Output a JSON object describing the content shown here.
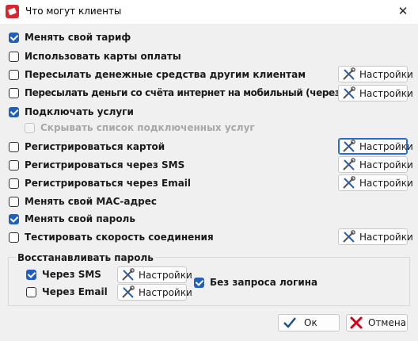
{
  "window": {
    "title": "Что могут клиенты"
  },
  "options": [
    {
      "label": "Менять свой тариф",
      "checked": true,
      "disabled": false,
      "button": null
    },
    {
      "label": "Использовать карты оплаты",
      "checked": false,
      "disabled": false,
      "button": null
    },
    {
      "label": "Пересылать денежные средства другим клиентам",
      "checked": false,
      "disabled": false,
      "button": "Настройки"
    },
    {
      "label": "Пересылать деньги со счёта интернет на мобильный (через Qiwi)",
      "checked": false,
      "disabled": false,
      "button": "Настройки"
    },
    {
      "label": "Подключать услуги",
      "checked": true,
      "disabled": false,
      "button": null
    },
    {
      "label": "Скрывать список подключенных услуг",
      "checked": false,
      "disabled": true,
      "button": null
    },
    {
      "label": "Регистрироваться картой",
      "checked": false,
      "disabled": false,
      "button": "Настройки"
    },
    {
      "label": "Регистрироваться через SMS",
      "checked": false,
      "disabled": false,
      "button": "Настройки"
    },
    {
      "label": "Регистрироваться через Email",
      "checked": false,
      "disabled": false,
      "button": "Настройки"
    },
    {
      "label": "Менять свой МАС-адрес",
      "checked": false,
      "disabled": false,
      "button": null
    },
    {
      "label": "Менять свой пароль",
      "checked": true,
      "disabled": false,
      "button": null
    },
    {
      "label": "Тестировать скорость соединения",
      "checked": false,
      "disabled": false,
      "button": "Настройки"
    }
  ],
  "password_group": {
    "title": "Восстанавливать пароль",
    "sms": {
      "label": "Через SMS",
      "checked": true,
      "button": "Настройки"
    },
    "email": {
      "label": "Через Email",
      "checked": false,
      "button": "Настройки"
    },
    "no_login": {
      "label": "Без запроса логина",
      "checked": true
    }
  },
  "footer": {
    "ok": "Ок",
    "cancel": "Отмена"
  },
  "icons": {
    "settings": "tools-icon",
    "ok": "checkmark-icon",
    "cancel": "cross-icon",
    "close": "close-icon"
  },
  "colors": {
    "accent": "#1f5fbf",
    "app_icon": "#d8262e",
    "cancel_red": "#d0021b"
  }
}
